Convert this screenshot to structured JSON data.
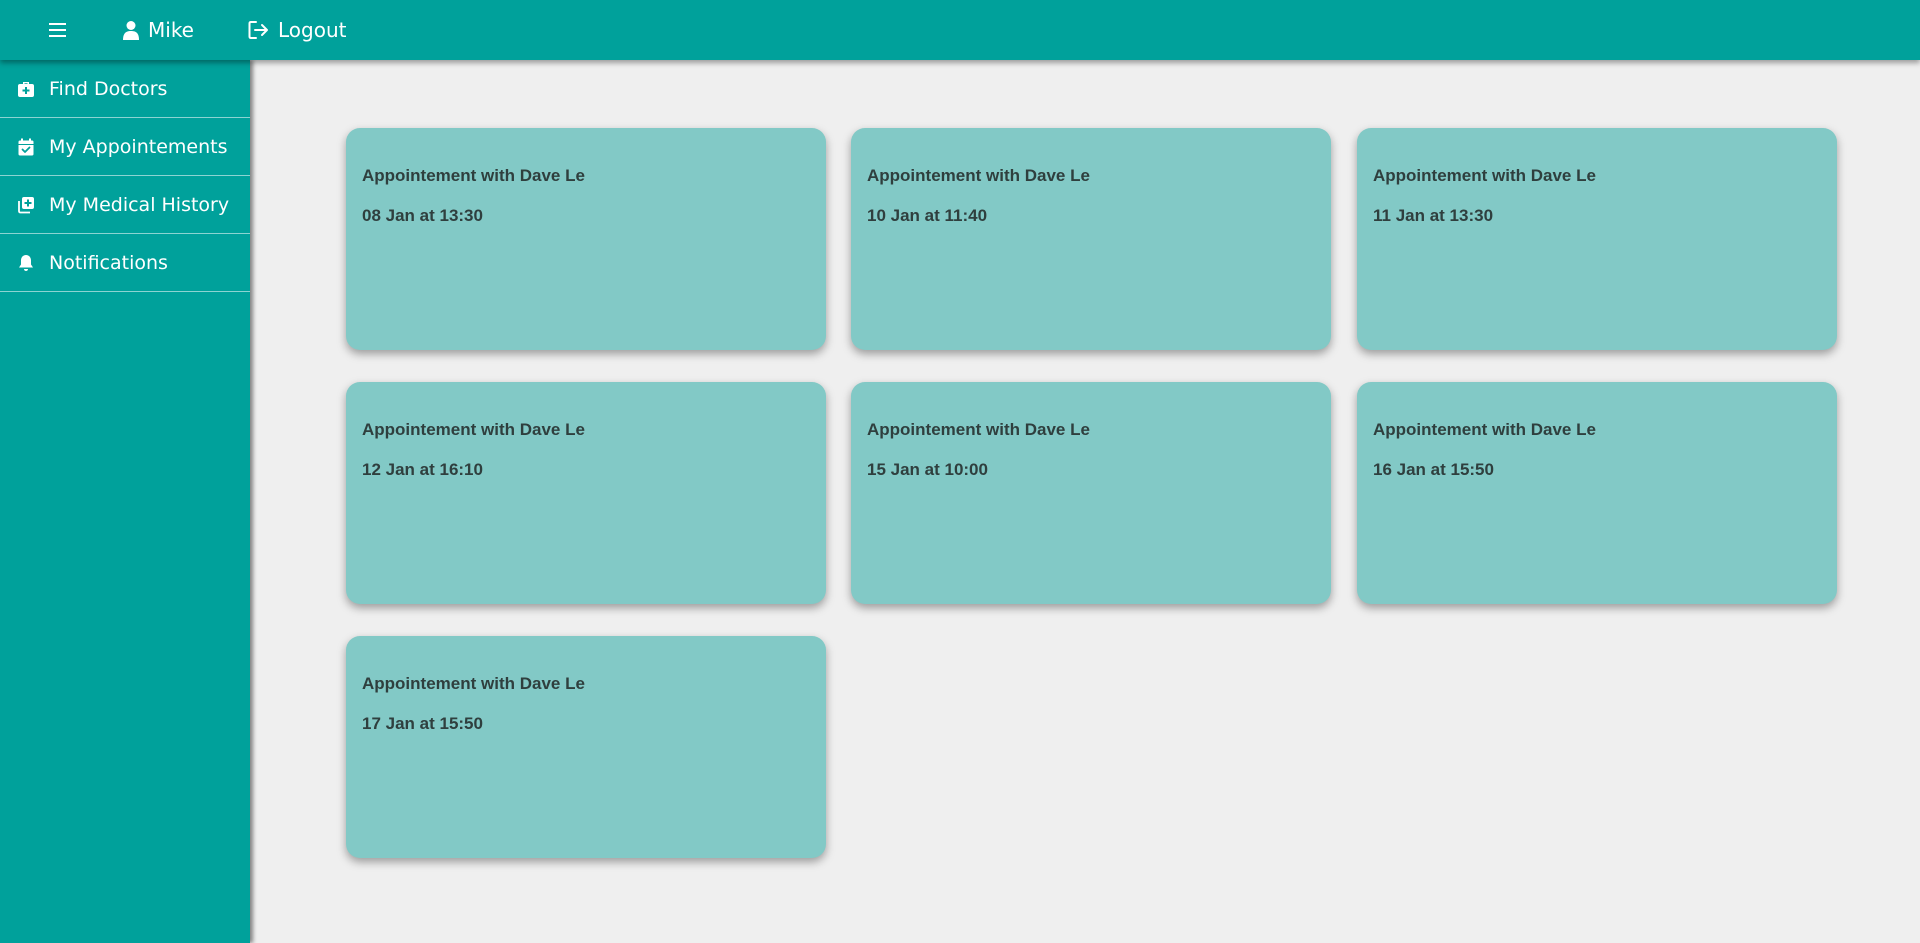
{
  "header": {
    "user_name": "Mike",
    "logout_label": "Logout"
  },
  "sidebar": {
    "items": [
      {
        "label": "Find Doctors",
        "icon": "medical-kit-icon"
      },
      {
        "label": "My Appointements",
        "icon": "calendar-check-icon"
      },
      {
        "label": "My Medical History",
        "icon": "medical-history-icon"
      },
      {
        "label": "Notifications",
        "icon": "bell-icon"
      }
    ]
  },
  "appointments": [
    {
      "title": "Appointement with Dave Le",
      "datetime": "08 Jan at 13:30"
    },
    {
      "title": "Appointement with Dave Le",
      "datetime": "10 Jan at 11:40"
    },
    {
      "title": "Appointement with Dave Le",
      "datetime": "11 Jan at 13:30"
    },
    {
      "title": "Appointement with Dave Le",
      "datetime": "12 Jan at 16:10"
    },
    {
      "title": "Appointement with Dave Le",
      "datetime": "15 Jan at 10:00"
    },
    {
      "title": "Appointement with Dave Le",
      "datetime": "16 Jan at 15:50"
    },
    {
      "title": "Appointement with Dave Le",
      "datetime": "17 Jan at 15:50"
    }
  ],
  "colors": {
    "primary": "#00a19b",
    "card": "#82c9c6",
    "background": "#efefef"
  }
}
